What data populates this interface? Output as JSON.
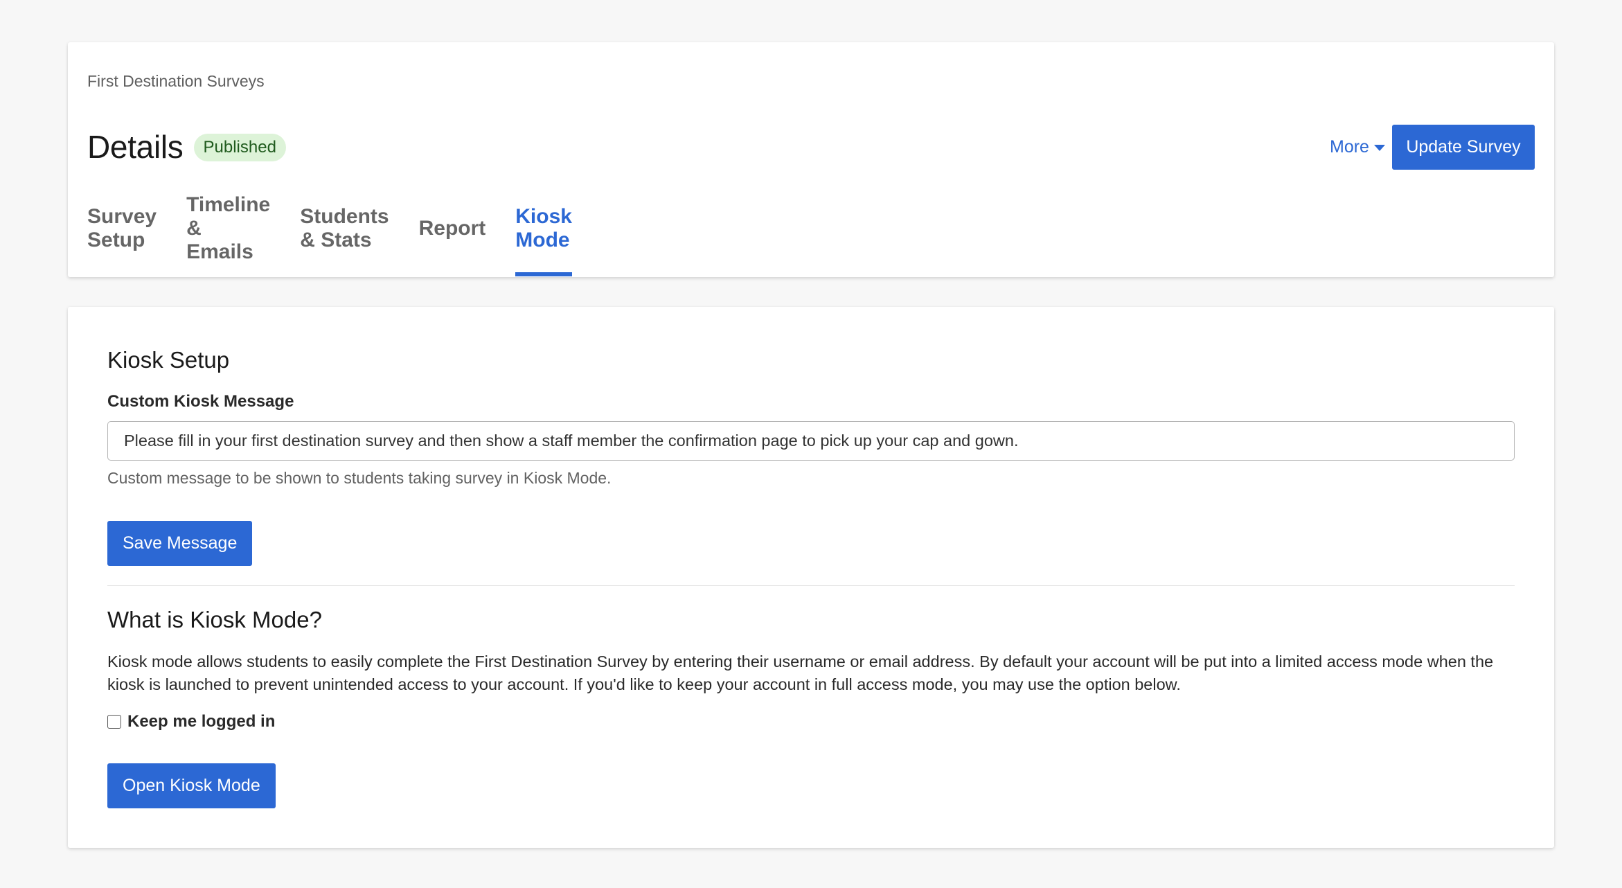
{
  "header": {
    "breadcrumb": "First Destination Surveys",
    "title": "Details",
    "status": "Published",
    "more_label": "More",
    "update_label": "Update Survey"
  },
  "tabs": [
    {
      "label": "Survey Setup",
      "active": false
    },
    {
      "label": "Timeline & Emails",
      "active": false
    },
    {
      "label": "Students & Stats",
      "active": false
    },
    {
      "label": "Report",
      "active": false
    },
    {
      "label": "Kiosk Mode",
      "active": true
    }
  ],
  "kiosk_setup": {
    "heading": "Kiosk Setup",
    "field_label": "Custom Kiosk Message",
    "message_value": "Please fill in your first destination survey and then show a staff member the confirmation page to pick up your cap and gown.",
    "help_text": "Custom message to be shown to students taking survey in Kiosk Mode.",
    "save_label": "Save Message"
  },
  "about": {
    "heading": "What is Kiosk Mode?",
    "description": "Kiosk mode allows students to easily complete the First Destination Survey by entering their username or email address. By default your account will be put into a limited access mode when the kiosk is launched to prevent unintended access to your account. If you'd like to keep your account in full access mode, you may use the option below.",
    "checkbox_label": "Keep me logged in",
    "checkbox_checked": false,
    "open_label": "Open Kiosk Mode"
  },
  "colors": {
    "accent": "#2c68d4",
    "badge_bg": "#ddf3d8",
    "badge_text": "#1f5a1d",
    "page_bg": "#f7f7f7"
  },
  "icons": {
    "more_caret": "caret-down-icon"
  }
}
